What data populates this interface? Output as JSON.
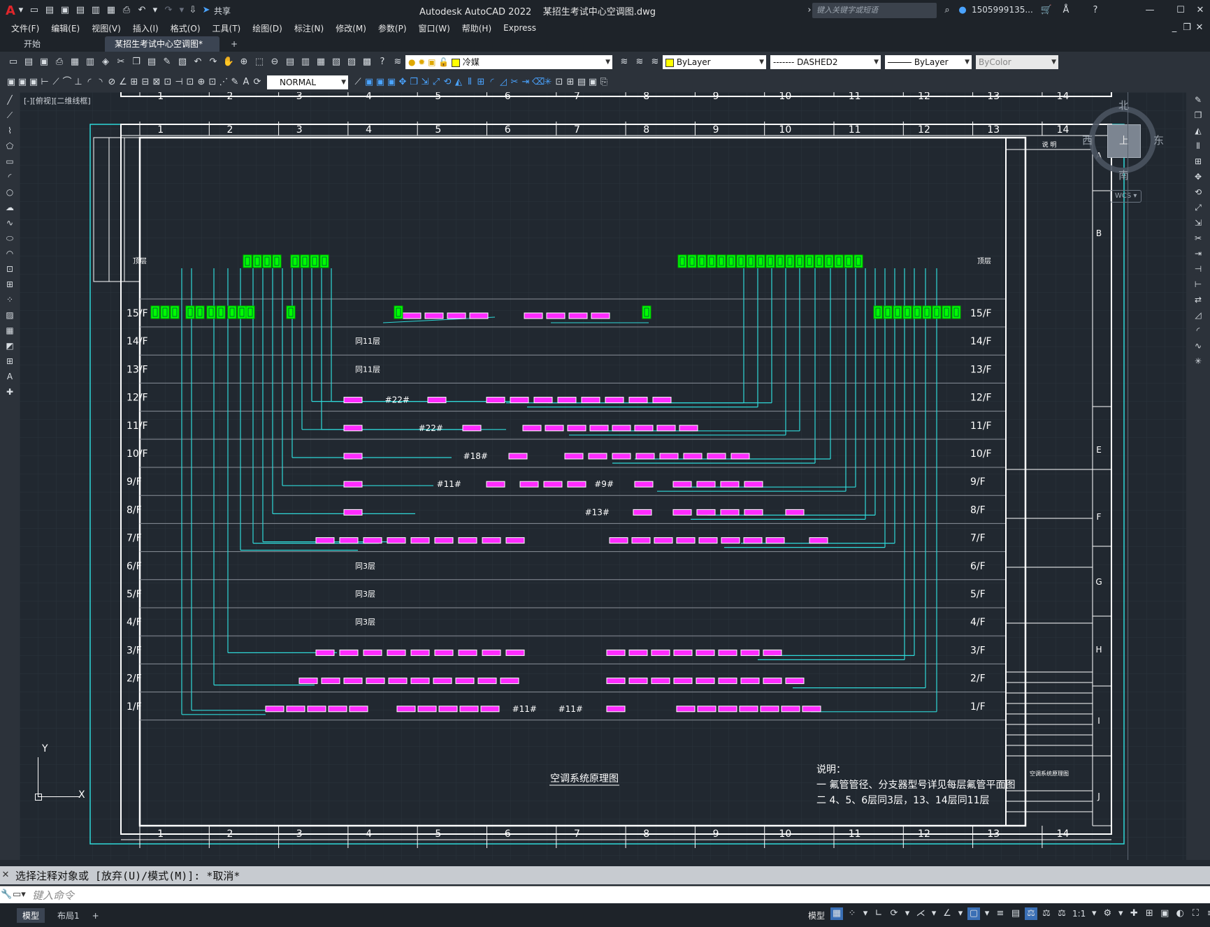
{
  "app": {
    "title": "Autodesk AutoCAD 2022    某招生考试中心空调图.dwg",
    "share_label": "共享",
    "search_placeholder": "键入关键字或短语",
    "user": "1505999135...",
    "app_letter": "A"
  },
  "menu": [
    "文件(F)",
    "编辑(E)",
    "视图(V)",
    "插入(I)",
    "格式(O)",
    "工具(T)",
    "绘图(D)",
    "标注(N)",
    "修改(M)",
    "参数(P)",
    "窗口(W)",
    "帮助(H)",
    "Express"
  ],
  "tabs": {
    "start": "开始",
    "drawing": "某招生考试中心空调图*",
    "add": "+"
  },
  "props": {
    "layer": "冷媒",
    "color": "ByLayer",
    "linetype": "------- DASHED2",
    "lineweight": "ByLayer",
    "plotstyle": "ByColor",
    "dimstyle": "NORMAL"
  },
  "viewport_label": "[-][俯视][二维线框]",
  "viewcube": {
    "north": "北",
    "south": "南",
    "east": "东",
    "west": "西",
    "top": "上",
    "wcs": "WCS"
  },
  "ucs": {
    "y": "Y",
    "x": "X"
  },
  "drawing": {
    "grid_numbers": [
      "1",
      "2",
      "3",
      "4",
      "5",
      "6",
      "7",
      "8",
      "9",
      "10",
      "11",
      "12",
      "13",
      "14"
    ],
    "row_letters": [
      "A",
      "B",
      "E",
      "F",
      "G",
      "H",
      "I",
      "J"
    ],
    "roof": "顶层",
    "floors": [
      "15/F",
      "14/F",
      "13/F",
      "12/F",
      "11/F",
      "10/F",
      "9/F",
      "8/F",
      "7/F",
      "6/F",
      "5/F",
      "4/F",
      "3/F",
      "2/F",
      "1/F"
    ],
    "floor_notes": [
      {
        "floor": "14/F",
        "text": "同11层"
      },
      {
        "floor": "13/F",
        "text": "同11层"
      },
      {
        "floor": "6/F",
        "text": "同3层"
      },
      {
        "floor": "5/F",
        "text": "同3层"
      },
      {
        "floor": "4/F",
        "text": "同3层"
      }
    ],
    "unit_labels": [
      "#22#",
      "#22#",
      "#18#",
      "#11#",
      "#9#",
      "#13#",
      "#11#",
      "#11#"
    ],
    "diagram_title": "空调系统原理图",
    "notes_title": "说明：",
    "notes": [
      "一 氟管管径、分支器型号详见每层氟管平面图",
      "二 4、5、6层同3层，13、14层同11层"
    ],
    "titleblock_header": "说  明",
    "titleblock_drawing_name": "空调系统原理图"
  },
  "command": {
    "history": "选择注释对象或 [放弃(U)/模式(M)]: *取消*",
    "input_placeholder": "键入命令"
  },
  "status": {
    "layout_tabs": [
      "模型",
      "布局1"
    ],
    "add": "+",
    "model": "模型",
    "scale": "1:1"
  },
  "colors": {
    "cyan": "#2fd8d8",
    "green": "#00ff00",
    "magenta": "#ff2bff",
    "white": "#ffffff",
    "grid": "#2a323c",
    "bg": "#212830"
  }
}
